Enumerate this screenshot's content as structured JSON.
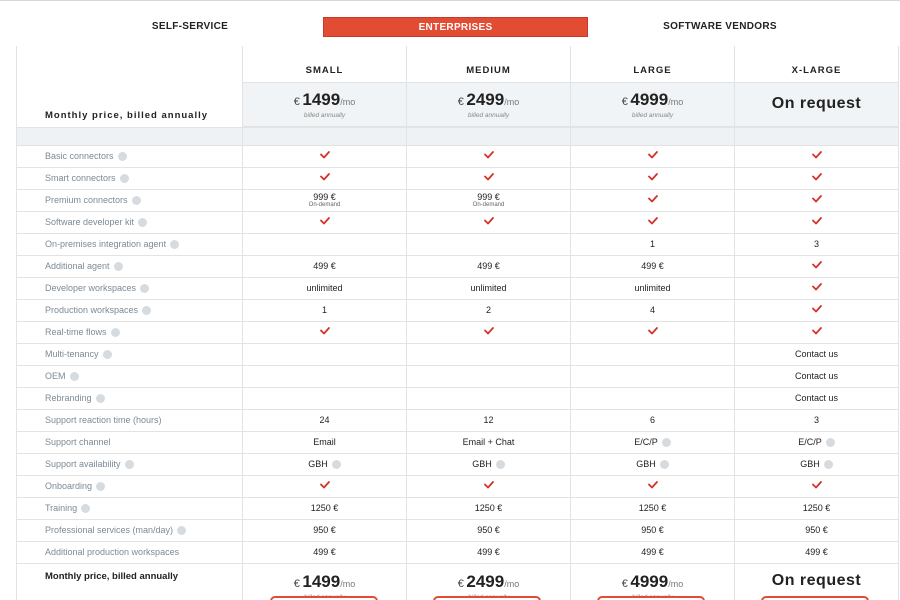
{
  "tabs": [
    {
      "label": "SELF-SERVICE",
      "active": false
    },
    {
      "label": "ENTERPRISES",
      "active": true
    },
    {
      "label": "SOFTWARE VENDORS",
      "active": false
    }
  ],
  "accent_color": "#e24c33",
  "check_color": "#d1342a",
  "table": {
    "price_label": "Monthly price, billed annually",
    "plans": [
      {
        "name": "SMALL",
        "currency": "€",
        "price": "1499",
        "per": "/mo",
        "note": "billed annually"
      },
      {
        "name": "MEDIUM",
        "currency": "€",
        "price": "2499",
        "per": "/mo",
        "note": "billed annually"
      },
      {
        "name": "LARGE",
        "currency": "€",
        "price": "4999",
        "per": "/mo",
        "note": "billed annually"
      },
      {
        "name": "X-LARGE",
        "on_request": "On request"
      }
    ],
    "features": [
      {
        "label": "Basic connectors",
        "values": [
          "check",
          "check",
          "check",
          "check"
        ]
      },
      {
        "label": "Smart connectors",
        "values": [
          "check",
          "check",
          "check",
          "check"
        ]
      },
      {
        "label": "Premium connectors",
        "values": [
          {
            "main": "999 €",
            "sub": "On-demand"
          },
          {
            "main": "999 €",
            "sub": "On-demand"
          },
          "check",
          "check"
        ]
      },
      {
        "label": "Software developer kit",
        "values": [
          "check",
          "check",
          "check",
          "check"
        ]
      },
      {
        "label": "On-premises integration agent",
        "values": [
          "",
          "",
          "1",
          "3"
        ]
      },
      {
        "label": "Additional agent",
        "values": [
          "499 €",
          "499 €",
          "499 €",
          "check"
        ]
      },
      {
        "label": "Developer workspaces",
        "values": [
          "unlimited",
          "unlimited",
          "unlimited",
          "check"
        ]
      },
      {
        "label": "Production workspaces",
        "values": [
          "1",
          "2",
          "4",
          "check"
        ]
      },
      {
        "label": "Real-time flows",
        "values": [
          "check",
          "check",
          "check",
          "check"
        ]
      },
      {
        "label": "Multi-tenancy",
        "values": [
          "",
          "",
          "",
          "Contact us"
        ]
      },
      {
        "label": "OEM",
        "values": [
          "",
          "",
          "",
          "Contact us"
        ]
      },
      {
        "label": "Rebranding",
        "values": [
          "",
          "",
          "",
          "Contact us"
        ]
      },
      {
        "label": "Support reaction time (hours)",
        "values": [
          "24",
          "12",
          "6",
          "3"
        ],
        "no_info": true
      },
      {
        "label": "Support channel",
        "values": [
          "Email",
          "Email + Chat",
          {
            "main": "E/C/P",
            "info": true
          },
          {
            "main": "E/C/P",
            "info": true
          }
        ],
        "no_info": true
      },
      {
        "label": "Support availability",
        "values": [
          {
            "main": "GBH",
            "info": true
          },
          {
            "main": "GBH",
            "info": true
          },
          {
            "main": "GBH",
            "info": true
          },
          {
            "main": "GBH",
            "info": true
          }
        ]
      },
      {
        "label": "Onboarding",
        "values": [
          "check",
          "check",
          "check",
          "check"
        ]
      },
      {
        "label": "Training",
        "values": [
          "1250 €",
          "1250 €",
          "1250 €",
          "1250 €"
        ]
      },
      {
        "label": "Professional services (man/day)",
        "values": [
          "950 €",
          "950 €",
          "950 €",
          "950 €"
        ]
      },
      {
        "label": "Additional production workspaces",
        "values": [
          "499 €",
          "499 €",
          "499 €",
          "499 €"
        ],
        "no_info": true
      }
    ]
  }
}
